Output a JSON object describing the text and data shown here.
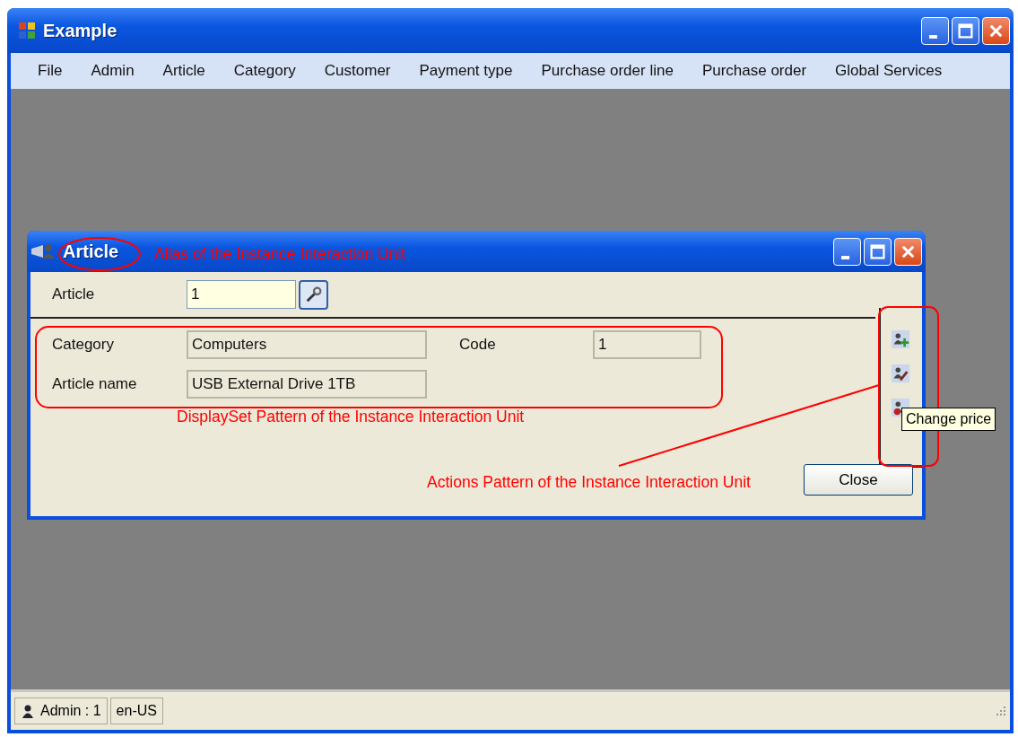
{
  "window": {
    "title": "Example"
  },
  "menu": [
    {
      "label": "File"
    },
    {
      "label": "Admin"
    },
    {
      "label": "Article"
    },
    {
      "label": "Category"
    },
    {
      "label": "Customer"
    },
    {
      "label": "Payment type"
    },
    {
      "label": "Purchase order line"
    },
    {
      "label": "Purchase order"
    },
    {
      "label": "Global Services"
    }
  ],
  "child_window": {
    "title": "Article",
    "header_field": {
      "label": "Article",
      "value": "1"
    },
    "fields": [
      {
        "label": "Category",
        "value": "Computers",
        "kind": "wide"
      },
      {
        "label": "Code",
        "value": "1",
        "kind": "narrow"
      },
      {
        "label": "Article name",
        "value": "USB External Drive 1TB",
        "kind": "wide"
      }
    ],
    "actions": [
      {
        "kind": "add"
      },
      {
        "kind": "edit"
      },
      {
        "kind": "delete"
      }
    ],
    "tooltip": "Change price",
    "close_button": "Close"
  },
  "annotations": [
    {
      "kind": "alias",
      "text": "Alias of the Instance Interaction Unit"
    },
    {
      "kind": "displayset",
      "text": "DisplaySet Pattern of the Instance Interaction Unit"
    },
    {
      "kind": "actions",
      "text": "Actions Pattern of the Instance Interaction Unit"
    }
  ],
  "status_bar": {
    "user": "Admin : 1",
    "culture": "en-US"
  }
}
